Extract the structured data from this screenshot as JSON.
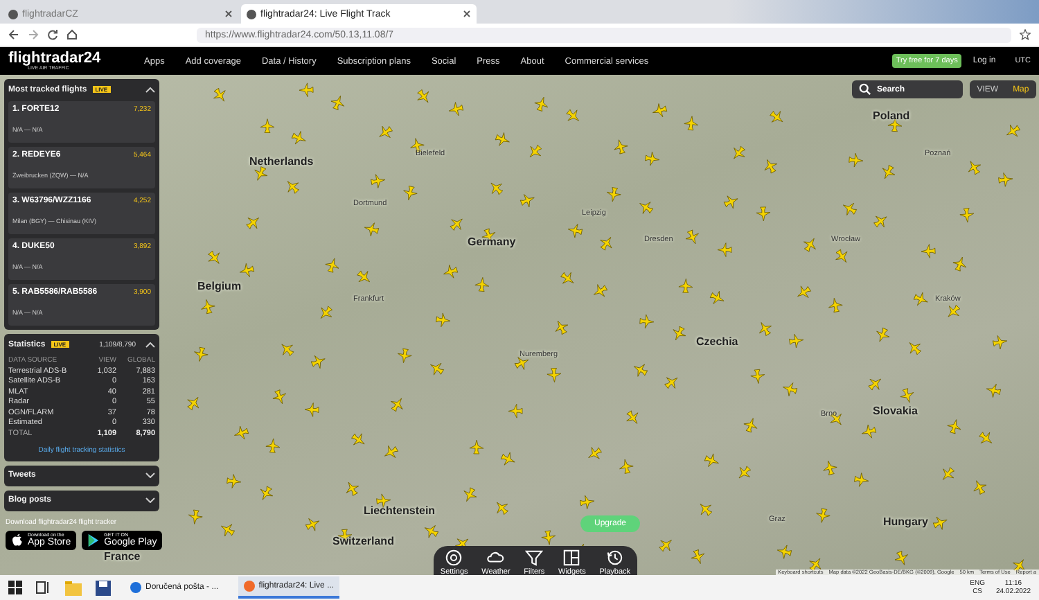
{
  "browser": {
    "tabs": [
      {
        "title": "flightradarCZ",
        "selected": false
      },
      {
        "title": "flightradar24: Live Flight Track",
        "selected": true
      }
    ],
    "url": "https://www.flightradar24.com/50.13,11.08/7"
  },
  "nav": {
    "logo": "flightradar24",
    "tagline": "LIVE AIR TRAFFIC",
    "items": [
      "Apps",
      "Add coverage",
      "Data / History",
      "Subscription plans",
      "Social",
      "Press",
      "About",
      "Commercial services"
    ],
    "trial": "Try free for 7 days",
    "login": "Log in",
    "utc": "UTC"
  },
  "map": {
    "labels": [
      {
        "text": "Netherlands",
        "kind": "country"
      },
      {
        "text": "Germany",
        "kind": "country"
      },
      {
        "text": "Belgium",
        "kind": "country"
      },
      {
        "text": "Czechia",
        "kind": "country"
      },
      {
        "text": "Slovakia",
        "kind": "country"
      },
      {
        "text": "Hungary",
        "kind": "country"
      },
      {
        "text": "Liechtenstein",
        "kind": "country"
      },
      {
        "text": "Switzerland",
        "kind": "country"
      },
      {
        "text": "France",
        "kind": "country"
      },
      {
        "text": "Poland",
        "kind": "country"
      },
      {
        "text": "Dortmund",
        "kind": "city"
      },
      {
        "text": "Bielefeld",
        "kind": "city"
      },
      {
        "text": "Leipzig",
        "kind": "city"
      },
      {
        "text": "Dresden",
        "kind": "city"
      },
      {
        "text": "Nuremberg",
        "kind": "city"
      },
      {
        "text": "Poznań",
        "kind": "city"
      },
      {
        "text": "Wrocław",
        "kind": "city"
      },
      {
        "text": "Kraków",
        "kind": "city"
      },
      {
        "text": "Frankfurt",
        "kind": "city"
      },
      {
        "text": "Brno",
        "kind": "city"
      },
      {
        "text": "Graz",
        "kind": "city"
      }
    ],
    "search": {
      "placeholder": "Search"
    },
    "view": {
      "label": "VIEW",
      "value": "Map"
    },
    "upgrade": "Upgrade",
    "attribution": [
      "Keyboard shortcuts",
      "Map data ©2022 GeoBasis-DE/BKG (©2009), Google",
      "50 km",
      "Terms of Use",
      "Report a"
    ]
  },
  "most_tracked": {
    "title": "Most tracked flights",
    "badge": "LIVE",
    "expanded": true,
    "flights": [
      {
        "name": "1. FORTE12",
        "route": "N/A — N/A",
        "count": "7,232"
      },
      {
        "name": "2. REDEYE6",
        "route": "Zweibrucken (ZQW) — N/A",
        "count": "5,464"
      },
      {
        "name": "3. W63796/WZZ1166",
        "route": "Milan (BGY) — Chisinau (KIV)",
        "count": "4,252"
      },
      {
        "name": "4. DUKE50",
        "route": "N/A — N/A",
        "count": "3,892"
      },
      {
        "name": "5. RAB5586/RAB5586",
        "route": "N/A — N/A",
        "count": "3,900"
      }
    ]
  },
  "statistics": {
    "title": "Statistics",
    "badge": "LIVE",
    "total": "1,109/8,790",
    "expanded": true,
    "columns": [
      "DATA SOURCE",
      "VIEW",
      "GLOBAL"
    ],
    "rows": [
      {
        "source": "Terrestrial ADS-B",
        "view": "1,032",
        "global": "7,883",
        "kind": "row"
      },
      {
        "source": "Satellite ADS-B",
        "view": "0",
        "global": "163",
        "kind": "row"
      },
      {
        "source": "MLAT",
        "view": "40",
        "global": "281",
        "kind": "row"
      },
      {
        "source": "Radar",
        "view": "0",
        "global": "55",
        "kind": "row"
      },
      {
        "source": "OGN/FLARM",
        "view": "37",
        "global": "78",
        "kind": "row"
      },
      {
        "source": "Estimated",
        "view": "0",
        "global": "330",
        "kind": "row"
      },
      {
        "source": "TOTAL",
        "view": "1,109",
        "global": "8,790",
        "kind": "total"
      }
    ],
    "link": "Daily flight tracking statistics"
  },
  "collapsed_panels": [
    {
      "title": "Tweets",
      "expanded": false
    },
    {
      "title": "Blog posts",
      "expanded": false
    }
  ],
  "download": {
    "text": "Download flightradar24 flight tracker",
    "app_store": {
      "small": "Download on the",
      "big": "App Store"
    },
    "google_play": {
      "small": "GET IT ON",
      "big": "Google Play"
    }
  },
  "toolbar": [
    "Settings",
    "Weather",
    "Filters",
    "Widgets",
    "Playback"
  ],
  "taskbar": {
    "apps": [
      {
        "title": "Doručená pošta - ...",
        "selected": false
      },
      {
        "title": "flightradar24: Live ...",
        "selected": true
      }
    ],
    "lang": "ENG",
    "layout": "CS",
    "time": "11:16",
    "date": "24.02.2022"
  }
}
